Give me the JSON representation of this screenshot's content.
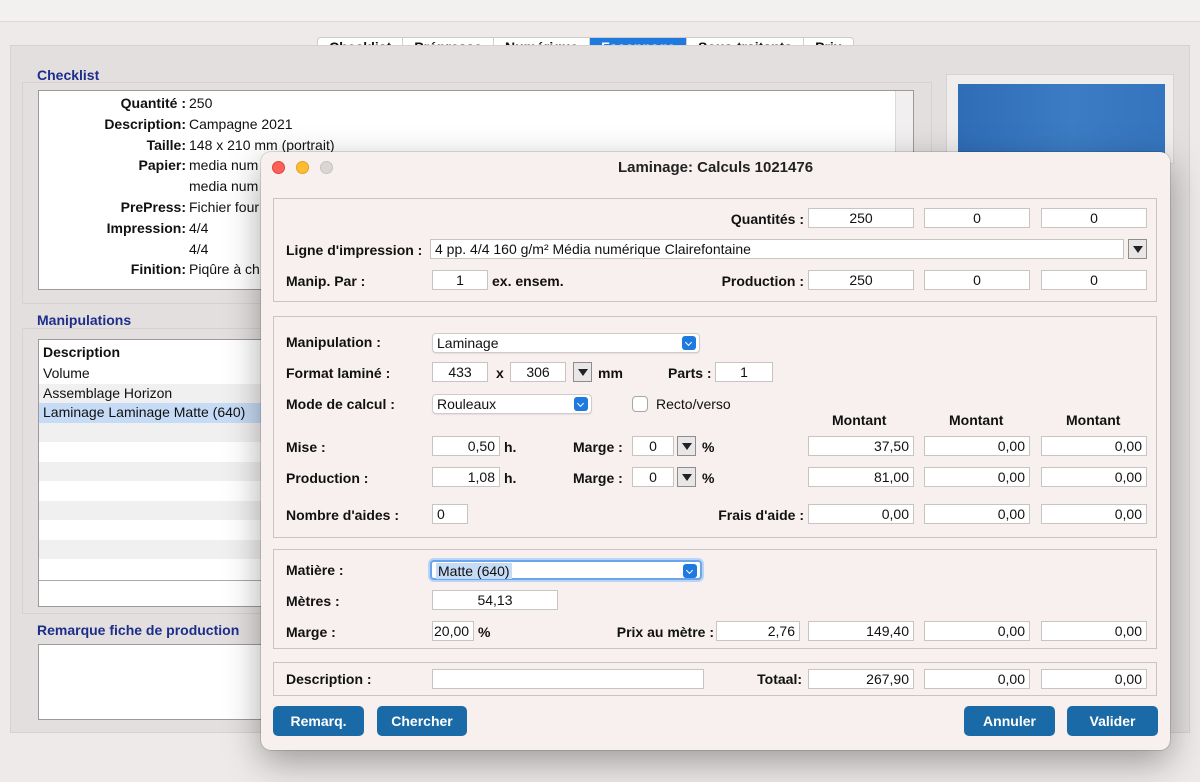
{
  "tabs": [
    "Checklist",
    "Prépresse",
    "Numérique",
    "Façonnage",
    "Sous-traitants",
    "Prix"
  ],
  "active_tab": "Façonnage",
  "checklist": {
    "title": "Checklist",
    "rows": [
      {
        "label": "Quantité :",
        "value": "250"
      },
      {
        "label": "Description:",
        "value": "Campagne 2021"
      },
      {
        "label": "Taille:",
        "value": "148 x 210 mm (portrait)"
      },
      {
        "label": "Papier:",
        "value": "media num"
      },
      {
        "label": "",
        "value": "media num"
      },
      {
        "label": "PrePress:",
        "value": "Fichier four"
      },
      {
        "label": "Impression:",
        "value": "4/4"
      },
      {
        "label": "",
        "value": "4/4"
      },
      {
        "label": "Finition:",
        "value": "Piqûre à ch"
      }
    ]
  },
  "manipulations": {
    "title": "Manipulations",
    "header": "Description",
    "items": [
      "Volume",
      "Assemblage Horizon",
      "Laminage Laminage Matte (640)"
    ],
    "selected_index": 2
  },
  "remarque": {
    "title": "Remarque fiche de production"
  },
  "dialog": {
    "title": "Laminage: Calculs 1021476",
    "quantites_label": "Quantités :",
    "quantites": [
      "250",
      "0",
      "0"
    ],
    "ligne_label": "Ligne d'impression :",
    "ligne_value": "4 pp. 4/4 160 g/m² Média numérique Clairefontaine",
    "manip_par_label": "Manip. Par :",
    "manip_par_value": "1",
    "manip_par_suffix": "ex. ensem.",
    "production_label": "Production :",
    "production": [
      "250",
      "0",
      "0"
    ],
    "manipulation_label": "Manipulation :",
    "manipulation_value": "Laminage",
    "format_label": "Format laminé :",
    "format_w": "433",
    "format_x": "x",
    "format_h": "306",
    "format_unit": "mm",
    "parts_label": "Parts :",
    "parts_value": "1",
    "mode_label": "Mode de calcul :",
    "mode_value": "Rouleaux",
    "recto_verso_label": "Recto/verso",
    "recto_verso_checked": false,
    "montant_headers": [
      "Montant",
      "Montant",
      "Montant"
    ],
    "mise_label": "Mise :",
    "mise_value": "0,50",
    "mise_unit": "h.",
    "marge_label": "Marge :",
    "mise_marge": "0",
    "percent": "%",
    "mise_montants": [
      "37,50",
      "0,00",
      "0,00"
    ],
    "prod_label": "Production :",
    "prod_value": "1,08",
    "prod_unit": "h.",
    "prod_marge": "0",
    "prod_montants": [
      "81,00",
      "0,00",
      "0,00"
    ],
    "aides_label": "Nombre d'aides :",
    "aides_value": "0",
    "frais_label": "Frais d'aide :",
    "frais_montants": [
      "0,00",
      "0,00",
      "0,00"
    ],
    "matiere_label": "Matière :",
    "matiere_value": "Matte (640)",
    "metres_label": "Mètres :",
    "metres_value": "54,13",
    "marge2_label": "Marge :",
    "marge2_value": "20,00",
    "prix_label": "Prix au mètre :",
    "prix_value": "2,76",
    "matiere_montants": [
      "149,40",
      "0,00",
      "0,00"
    ],
    "description_label": "Description :",
    "description_value": "",
    "total_label": "Totaal:",
    "totals": [
      "267,90",
      "0,00",
      "0,00"
    ],
    "buttons": {
      "remarq": "Remarq.",
      "chercher": "Chercher",
      "annuler": "Annuler",
      "valider": "Valider"
    }
  },
  "colors": {
    "accent": "#1f7ae0",
    "button": "#1a6aa7",
    "section_title": "#1c2e8a",
    "selection": "#c6dbf5"
  }
}
